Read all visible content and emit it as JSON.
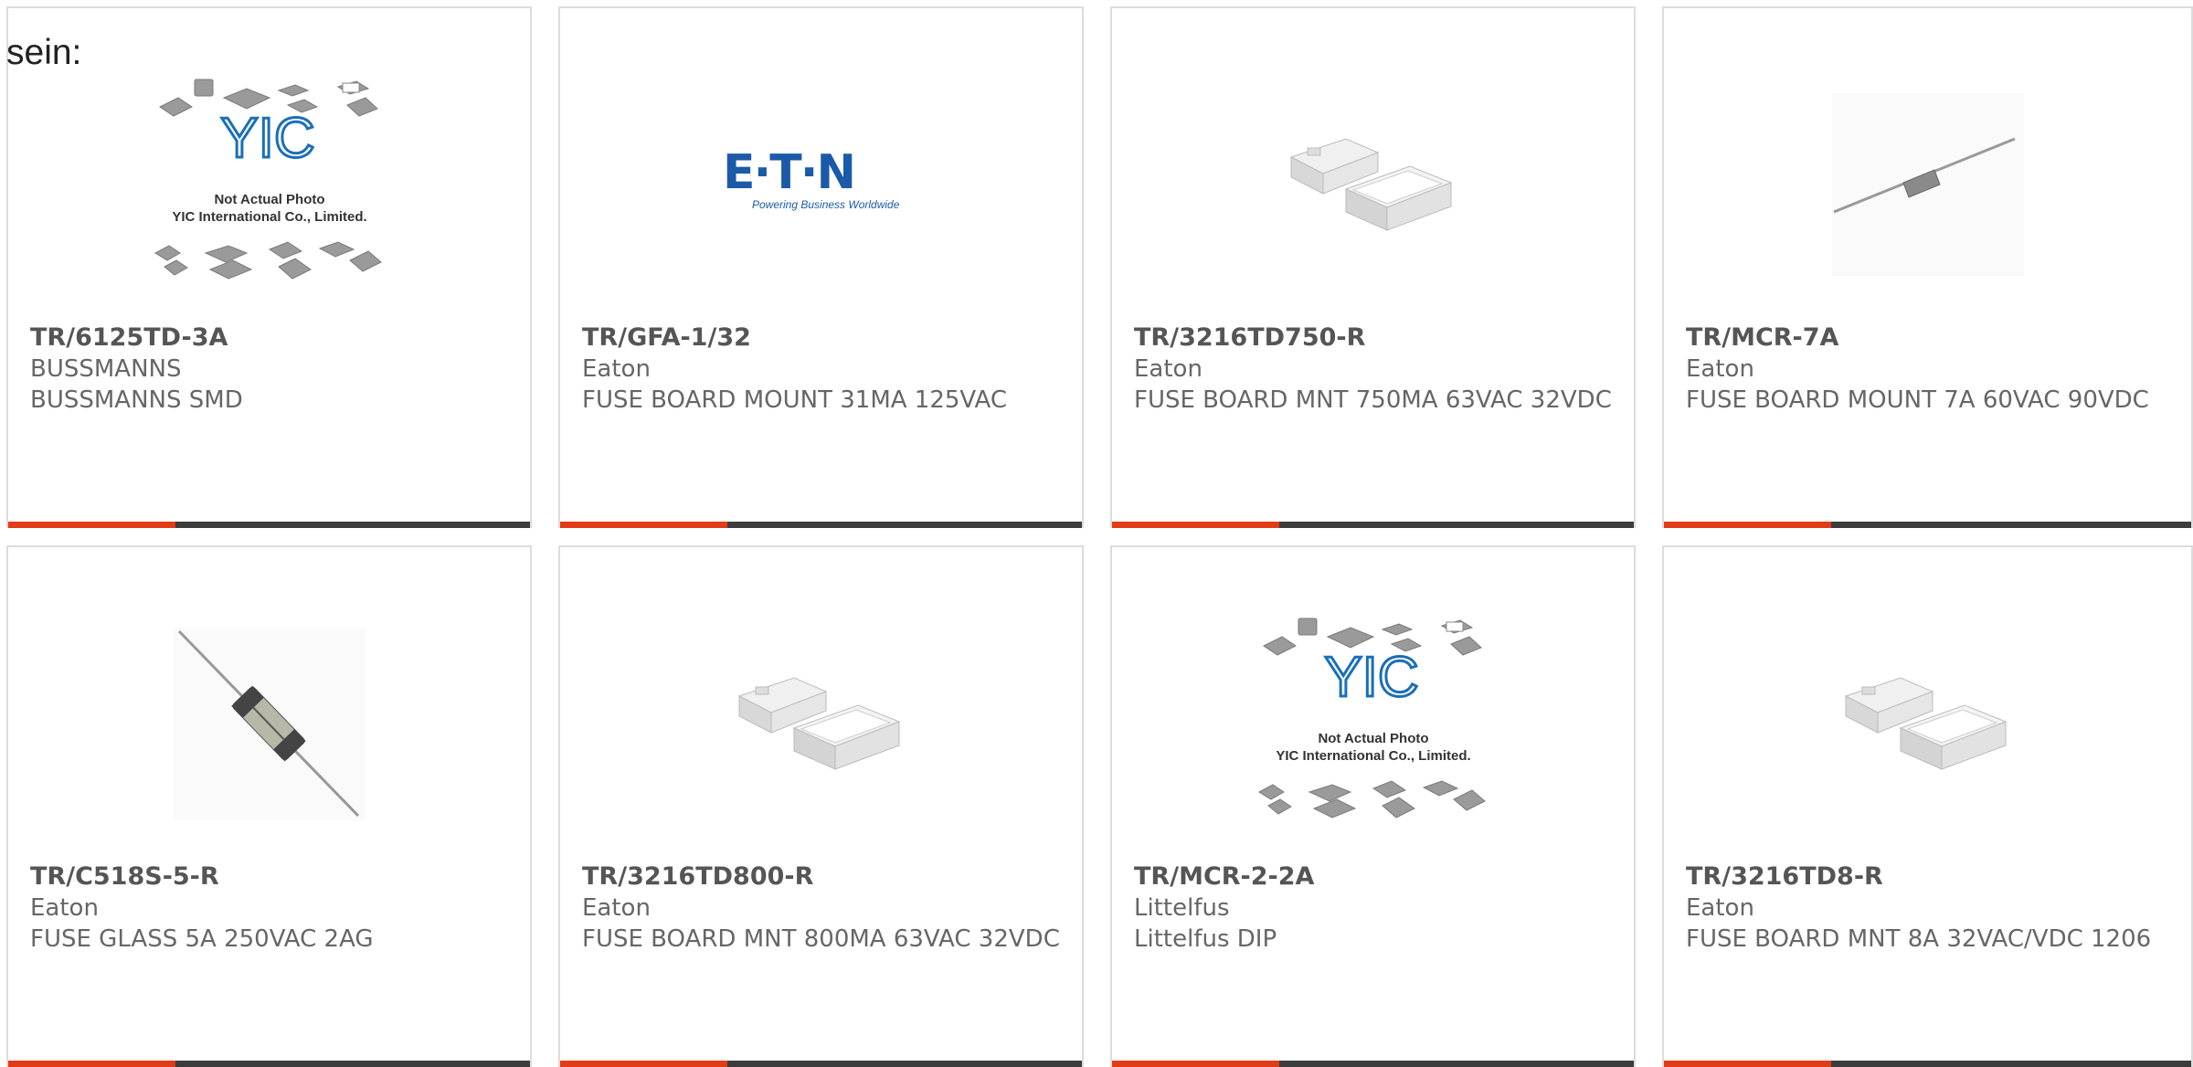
{
  "intro_text": "sein:",
  "colors": {
    "accent": "#e23c17",
    "bar": "#3c3c3c",
    "border": "#dcdcdc",
    "eaton_blue": "#1b5aa8",
    "yic_blue": "#1a6fb8"
  },
  "products": [
    {
      "part": "TR/6125TD-3A",
      "brand": "BUSSMANNS",
      "desc": "BUSSMANNS SMD",
      "image": "yic-placeholder",
      "placeholder_line1": "Not Actual Photo",
      "placeholder_line2": "YIC International Co., Limited.",
      "placeholder_logo": "YIC"
    },
    {
      "part": "TR/GFA-1/32",
      "brand": "Eaton",
      "desc": "FUSE BOARD MOUNT 31MA 125VAC",
      "image": "eaton-logo",
      "logo_text": "E·T·N",
      "logo_tagline": "Powering Business Worldwide"
    },
    {
      "part": "TR/3216TD750-R",
      "brand": "Eaton",
      "desc": "FUSE BOARD MNT 750MA 63VAC 32VDC",
      "image": "smd-fuse"
    },
    {
      "part": "TR/MCR-7A",
      "brand": "Eaton",
      "desc": "FUSE BOARD MOUNT 7A 60VAC 90VDC",
      "image": "axial-fuse"
    },
    {
      "part": "TR/C518S-5-R",
      "brand": "Eaton",
      "desc": "FUSE GLASS 5A 250VAC 2AG",
      "image": "glass-fuse"
    },
    {
      "part": "TR/3216TD800-R",
      "brand": "Eaton",
      "desc": "FUSE BOARD MNT 800MA 63VAC 32VDC",
      "image": "smd-fuse"
    },
    {
      "part": "TR/MCR-2-2A",
      "brand": "Littelfus",
      "desc": "Littelfus DIP",
      "image": "yic-placeholder",
      "placeholder_line1": "Not Actual Photo",
      "placeholder_line2": "YIC International Co., Limited.",
      "placeholder_logo": "YIC"
    },
    {
      "part": "TR/3216TD8-R",
      "brand": "Eaton",
      "desc": "FUSE BOARD MNT 8A 32VAC/VDC 1206",
      "image": "smd-fuse"
    }
  ]
}
